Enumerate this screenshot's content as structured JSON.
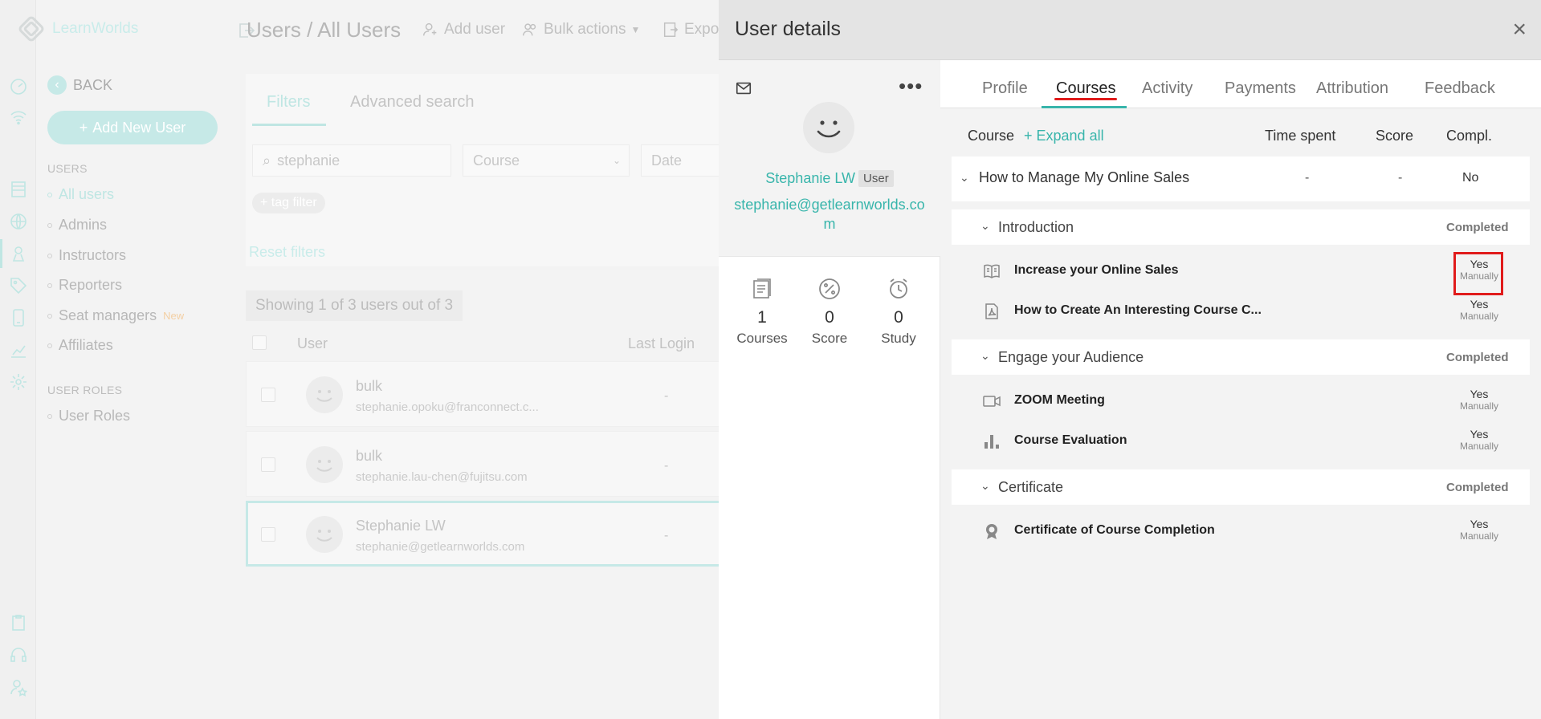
{
  "app": {
    "name": "LearnWorlds"
  },
  "sidebar": {
    "back_label": "BACK",
    "add_user_label": "Add New User",
    "section_users": "USERS",
    "items": [
      {
        "label": "All users",
        "active": true
      },
      {
        "label": "Admins"
      },
      {
        "label": "Instructors"
      },
      {
        "label": "Reporters"
      },
      {
        "label": "Seat managers",
        "badge": "New"
      },
      {
        "label": "Affiliates"
      }
    ],
    "section_roles": "USER ROLES",
    "roles_items": [
      {
        "label": "User Roles"
      }
    ]
  },
  "main": {
    "breadcrumb": "Users / All Users",
    "toolbar": {
      "add_user": "Add user",
      "bulk_actions": "Bulk actions",
      "export": "Expor"
    },
    "filter_tabs": [
      "Filters",
      "Advanced search"
    ],
    "search_value": "stephanie",
    "course_select": "Course",
    "date_select": "Date",
    "tag_filter": "+ tag filter",
    "reset_filters": "Reset filters",
    "showing": "Showing 1 of 3 users out of 3",
    "columns": {
      "user": "User",
      "last_login": "Last Login"
    },
    "rows": [
      {
        "name": "bulk",
        "email": "stephanie.opoku@franconnect.c...",
        "last_login": "-"
      },
      {
        "name": "bulk",
        "email": "stephanie.lau-chen@fujitsu.com",
        "last_login": "-"
      },
      {
        "name": "Stephanie LW",
        "email": "stephanie@getlearnworlds.com",
        "last_login": "-"
      }
    ]
  },
  "panel": {
    "title": "User details",
    "close": "×",
    "user": {
      "name": "Stephanie LW",
      "role": "User",
      "email": "stephanie@getlearnworlds.com"
    },
    "stats": [
      {
        "value": "1",
        "label": "Courses"
      },
      {
        "value": "0",
        "label": "Score"
      },
      {
        "value": "0",
        "label": "Study"
      }
    ],
    "tabs": [
      "Profile",
      "Courses",
      "Activity",
      "Payments",
      "Attribution",
      "Feedback"
    ],
    "active_tab": "Courses",
    "course_header": {
      "course": "Course",
      "expand_all": "+ Expand all",
      "time_spent": "Time spent",
      "score": "Score",
      "compl": "Compl."
    },
    "course": {
      "title": "How to Manage My Online Sales",
      "time_spent": "-",
      "score": "-",
      "completed": "No"
    },
    "sections": [
      {
        "title": "Introduction",
        "status": "Completed",
        "lessons": [
          {
            "icon": "ebook-icon",
            "title": "Increase your Online Sales",
            "completed": "Yes",
            "method": "Manually"
          },
          {
            "icon": "pdf-icon",
            "title": "How to Create An Interesting Course C...",
            "completed": "Yes",
            "method": "Manually"
          }
        ]
      },
      {
        "title": "Engage your Audience",
        "status": "Completed",
        "lessons": [
          {
            "icon": "video-call-icon",
            "title": "ZOOM Meeting",
            "completed": "Yes",
            "method": "Manually"
          },
          {
            "icon": "bar-chart-icon",
            "title": "Course Evaluation",
            "completed": "Yes",
            "method": "Manually"
          }
        ]
      },
      {
        "title": "Certificate",
        "status": "Completed",
        "lessons": [
          {
            "icon": "certificate-icon",
            "title": "Certificate of Course Completion",
            "completed": "Yes",
            "method": "Manually"
          }
        ]
      }
    ]
  },
  "colors": {
    "accent": "#38b5ab",
    "highlight": "#e01b1b"
  }
}
